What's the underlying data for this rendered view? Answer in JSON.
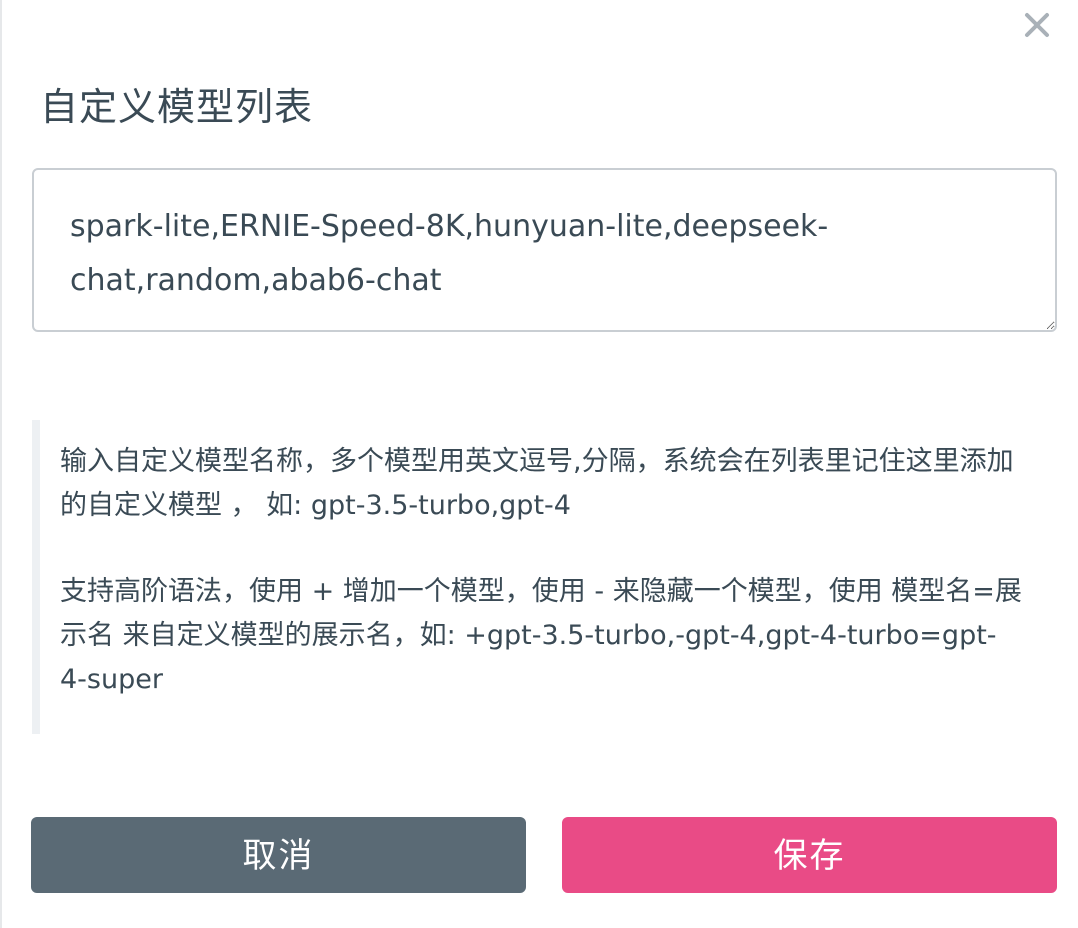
{
  "dialog": {
    "title": "自定义模型列表",
    "close_icon": "close-icon"
  },
  "models_input": {
    "value": "spark-lite,ERNIE-Speed-8K,hunyuan-lite,deepseek-chat,random,abab6-chat"
  },
  "help": {
    "paragraph1": "输入自定义模型名称，多个模型用英文逗号,分隔，系统会在列表里记住这里添加的自定义模型 ， 如: gpt-3.5-turbo,gpt-4",
    "paragraph2": "支持高阶语法，使用 + 增加一个模型，使用 - 来隐藏一个模型，使用 模型名=展示名 来自定义模型的展示名，如: +gpt-3.5-turbo,-gpt-4,gpt-4-turbo=gpt-4-super"
  },
  "buttons": {
    "cancel_label": "取消",
    "save_label": "保存"
  },
  "colors": {
    "cancel": "#5a6a75",
    "save": "#e94b86",
    "text": "#3a4a55"
  }
}
